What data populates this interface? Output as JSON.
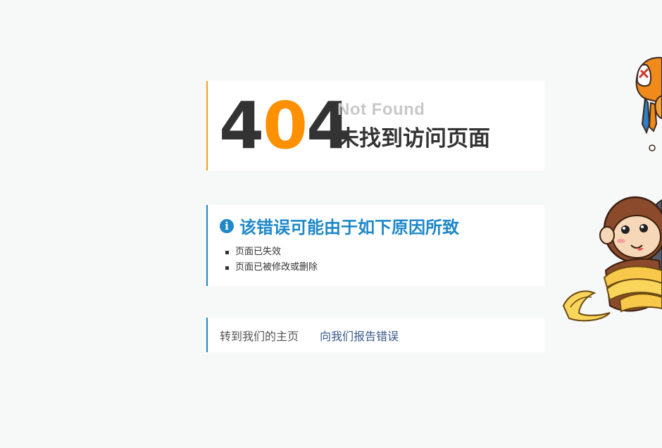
{
  "error": {
    "digits": [
      "4",
      "0",
      "4"
    ],
    "not_found_en": "Not Found",
    "not_found_zh": "未找到访问页面"
  },
  "reasons": {
    "icon": "info-icon",
    "title": "该错误可能由于如下原因所致",
    "items": [
      "页面已失效",
      "页面已被修改或删除"
    ]
  },
  "links": {
    "home": "转到我们的主页",
    "report": "向我们报告错误"
  },
  "colors": {
    "accent_orange": "#ff9000",
    "accent_blue": "#1e88c8",
    "background": "#f7f8f8"
  }
}
